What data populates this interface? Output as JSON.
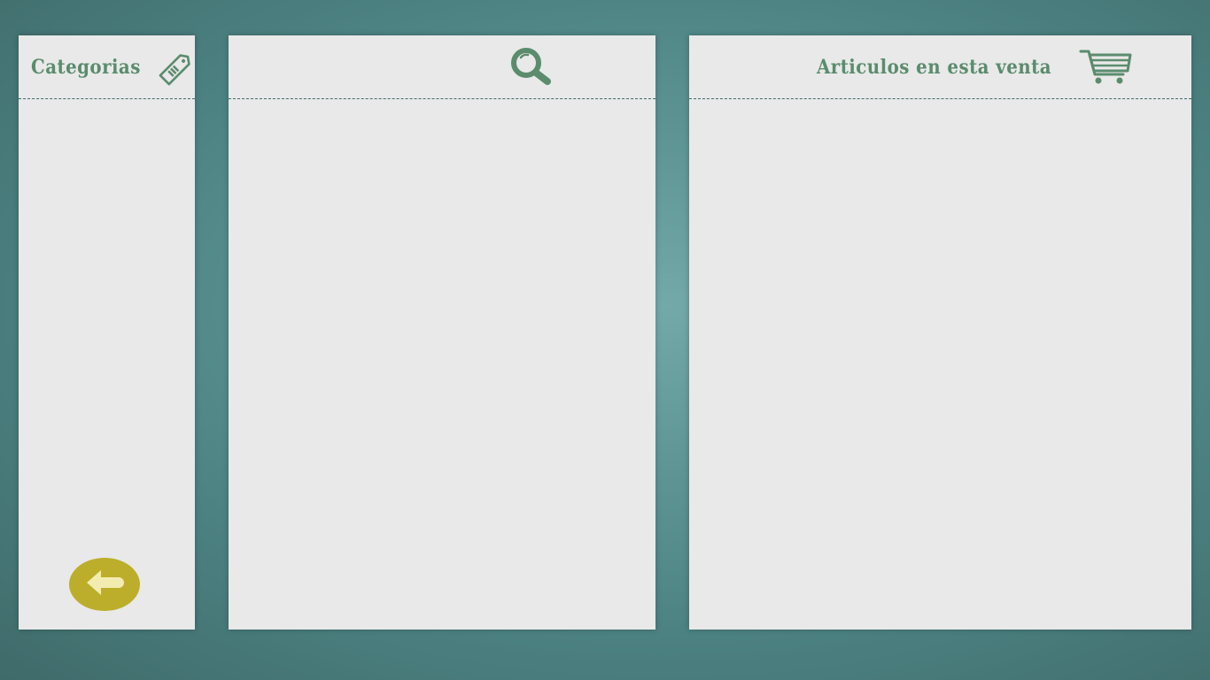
{
  "categories_panel": {
    "title": "Categorias",
    "icon": "tag-icon"
  },
  "products_panel": {
    "icon": "search-icon"
  },
  "cart_panel": {
    "title": "Articulos en esta venta",
    "icon": "cart-icon"
  },
  "back_button": {
    "icon": "arrow-left-icon"
  },
  "colors": {
    "accent_green": "#5a8c6d",
    "back_button": "#bcae2a",
    "arrow": "#f3ecb0",
    "panel_bg": "#e9e9e9",
    "background": "#4d8383"
  }
}
